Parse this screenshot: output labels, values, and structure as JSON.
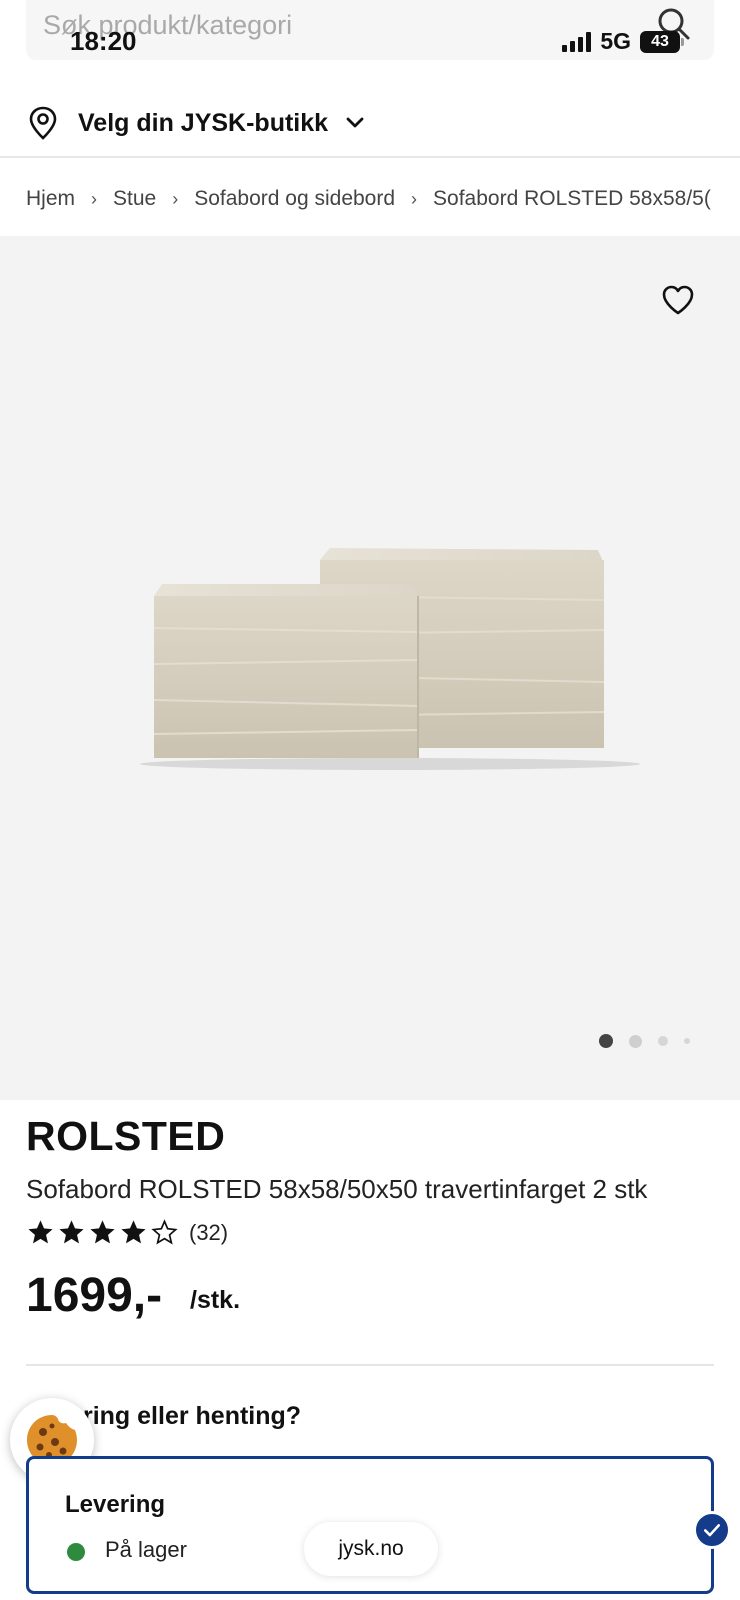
{
  "search": {
    "placeholder": "Søk produkt/kategori"
  },
  "status_bar": {
    "time": "18:20",
    "network": "5G",
    "battery": "43"
  },
  "store": {
    "label": "Velg din JYSK-butikk"
  },
  "breadcrumb": [
    "Hjem",
    "Stue",
    "Sofabord og sidebord",
    "Sofabord ROLSTED 58x58/5("
  ],
  "gallery": {
    "page_count": 4,
    "active_index": 0
  },
  "product": {
    "brand": "ROLSTED",
    "name": "Sofabord ROLSTED 58x58/50x50 travertinfarget 2 stk",
    "rating_stars": 4,
    "rating_max": 5,
    "review_count": "(32)",
    "price": "1699,-",
    "price_unit": "/stk."
  },
  "delivery": {
    "question": "ring eller henting?",
    "option_title": "Levering",
    "stock_status": "På lager"
  },
  "browser": {
    "url": "jysk.no"
  },
  "colors": {
    "accent": "#143c8a",
    "in_stock": "#2e8b3e",
    "gallery_bg": "#f3f3f3"
  }
}
